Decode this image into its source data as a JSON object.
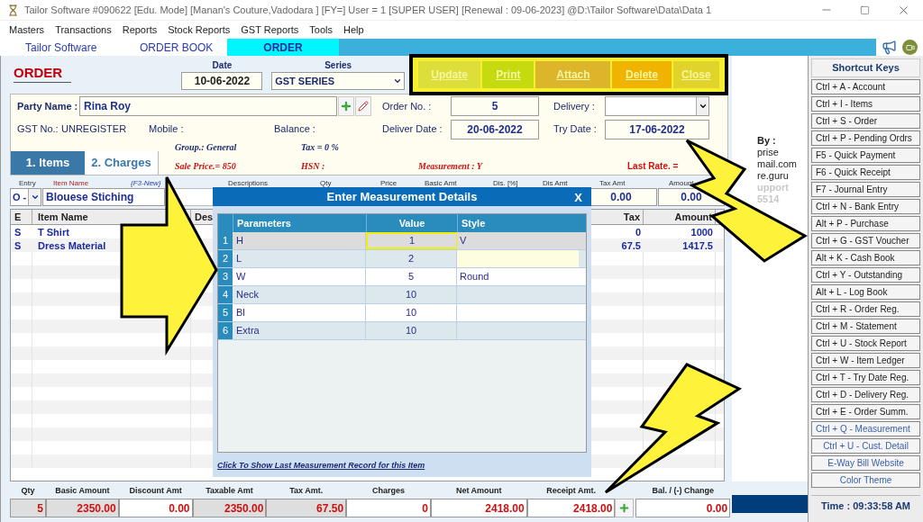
{
  "window": {
    "title": "Tailor Software #090622  [Edu. Mode] [Manan's Couture,Vadodara ] [FY=] User =  1 [SUPER USER]  [Renewal : 09-06-2023] @D:\\Tailor Software\\Data\\Data 1"
  },
  "menu": [
    "Masters",
    "Transactions",
    "Reports",
    "Stock Reports",
    "GST Reports",
    "Tools",
    "Help"
  ],
  "nav_tabs": [
    {
      "label": "Tailor Software",
      "selected": false
    },
    {
      "label": "ORDER BOOK",
      "selected": false
    },
    {
      "label": "ORDER",
      "selected": true
    }
  ],
  "form": {
    "title": "ORDER",
    "date_label": "Date",
    "date": "10-06-2022",
    "series_label": "Series",
    "series": "GST SERIES"
  },
  "actions": [
    {
      "label": "Update",
      "color": "#dede3a"
    },
    {
      "label": "Print",
      "color": "#c6da10"
    },
    {
      "label": "Attach",
      "color": "#dcb52a"
    },
    {
      "label": "Delete",
      "color": "#f0b400"
    },
    {
      "label": "Close",
      "color": "#e0d42a"
    }
  ],
  "party": {
    "name_label": "Party Name :",
    "name": "Rina Roy",
    "gst_label": "GST No.:",
    "gst": "UNREGISTER",
    "mobile_label": "Mobile :",
    "balance_label": "Balance :",
    "order_no_label": "Order No.  :",
    "order_no": "5",
    "deliver_date_label": "Deliver Date :",
    "deliver_date": "20-06-2022",
    "delivery_label": "Delivery :",
    "try_date_label": "Try Date  :",
    "try_date": "17-06-2022"
  },
  "item_info": {
    "group": "Group.: General",
    "tax": "Tax = 0 %",
    "sale_price": "Sale Price.= 850",
    "hsn": "HSN :",
    "measurement": "Measurement : Y",
    "last_rate": "Last Rate. ="
  },
  "section_tabs": [
    {
      "label": "1. Items",
      "selected": true
    },
    {
      "label": "2. Charges",
      "selected": false
    }
  ],
  "entry": {
    "headers": [
      "Entry",
      "Item Name",
      "{F3-New}",
      "Descriptions",
      "Qty",
      "Price",
      "Basic Amt",
      "Dis. [%]",
      "Dis Amt",
      "Tax Amt",
      "Amount"
    ],
    "type": "O -",
    "item": "Blouese Stiching",
    "tax_amt": "0.00",
    "amount": "0.00"
  },
  "items_table": {
    "columns": [
      "E",
      "Item Name",
      "Des",
      "Tax",
      "Amount"
    ],
    "rows": [
      {
        "e": "S",
        "item_name": "T Shirt",
        "tax": "0",
        "amount": "1000"
      },
      {
        "e": "S",
        "item_name": "Dress Material",
        "tax": "67.5",
        "amount": "1417.5"
      }
    ]
  },
  "contact": [
    {
      "text": "By :",
      "faded": false
    },
    {
      "text": "prise",
      "faded": false
    },
    {
      "text": "mail.com",
      "faded": false
    },
    {
      "text": "re.guru",
      "faded": false
    },
    {
      "text": "upport",
      "faded": true
    },
    {
      "text": "5514",
      "faded": true
    }
  ],
  "measurement_dialog": {
    "title": "Enter Measurement Details",
    "close": "X",
    "columns": [
      "Parameters",
      "Value",
      "Style"
    ],
    "rows": [
      {
        "no": "1",
        "parameter": "H",
        "value": "1",
        "style": "V",
        "selected": true,
        "style_active": false
      },
      {
        "no": "2",
        "parameter": "L",
        "value": "2",
        "style": "",
        "selected": false,
        "style_active": true
      },
      {
        "no": "3",
        "parameter": "W",
        "value": "5",
        "style": "Round",
        "selected": false,
        "style_active": false
      },
      {
        "no": "4",
        "parameter": "Neck",
        "value": "10",
        "style": "",
        "selected": false,
        "style_active": false
      },
      {
        "no": "5",
        "parameter": "Bl",
        "value": "10",
        "style": "",
        "selected": false,
        "style_active": false
      },
      {
        "no": "6",
        "parameter": "Extra",
        "value": "10",
        "style": "",
        "selected": false,
        "style_active": false
      }
    ],
    "link": "Click To Show Last Measurement Record for this Item"
  },
  "totals": [
    {
      "label": "Qty",
      "value": "5",
      "shaded": true
    },
    {
      "label": "Basic Amount",
      "value": "2350.00",
      "shaded": true
    },
    {
      "label": "Discount Amt",
      "value": "0.00",
      "shaded": false
    },
    {
      "label": "Taxable Amt",
      "value": "2350.00",
      "shaded": true
    },
    {
      "label": "Tax Amt.",
      "value": "67.50",
      "shaded": true
    },
    {
      "label": "Charges",
      "value": "0",
      "shaded": false
    },
    {
      "label": "Net Amount",
      "value": "2418.00",
      "shaded": false
    },
    {
      "label": "Receipt Amt.",
      "value": "2418.00",
      "shaded": false
    },
    {
      "label": "Bal. / (-) Change",
      "value": "0.00",
      "shaded": false
    }
  ],
  "shortcuts": {
    "title": "Shortcut Keys",
    "time": "Time : 09:33:58 AM",
    "items": [
      {
        "label": "Ctrl + A - Account",
        "kind": "key"
      },
      {
        "label": "Ctrl + I - Items",
        "kind": "key"
      },
      {
        "label": "Ctrl + S - Order",
        "kind": "key"
      },
      {
        "label": "Ctrl + P - Pending Ordrs",
        "kind": "key"
      },
      {
        "label": "F5 - Quick Payment",
        "kind": "key"
      },
      {
        "label": "F6 - Quick Receipt",
        "kind": "key"
      },
      {
        "label": "F7 - Journal Entry",
        "kind": "key"
      },
      {
        "label": "Ctrl + N - Bank Entry",
        "kind": "key"
      },
      {
        "label": "Alt + P - Purchase",
        "kind": "key"
      },
      {
        "label": "Ctrl + G - GST Voucher",
        "kind": "key"
      },
      {
        "label": "Alt + K - Cash Book",
        "kind": "key"
      },
      {
        "label": "Ctrl + Y  -  Outstanding",
        "kind": "key"
      },
      {
        "label": "Alt + L  -  Log Book",
        "kind": "key"
      },
      {
        "label": "Ctrl + R - Order Reg.",
        "kind": "key"
      },
      {
        "label": "Ctrl + M - Statement",
        "kind": "key"
      },
      {
        "label": "Ctrl + U - Stock Report",
        "kind": "key"
      },
      {
        "label": "Ctrl + W - Item Ledger",
        "kind": "key"
      },
      {
        "label": "Ctrl + T - Try Date Reg.",
        "kind": "key"
      },
      {
        "label": "Ctrl + D - Delivery Reg.",
        "kind": "key"
      },
      {
        "label": "Ctrl + E - Order Summ.",
        "kind": "key"
      },
      {
        "label": "Ctrl + Q - Measurement",
        "kind": "highlight"
      },
      {
        "label": "Ctrl + U - Cust. Detail",
        "kind": "tool"
      },
      {
        "label": "E-Way Bill Website",
        "kind": "tool"
      },
      {
        "label": "Color Theme",
        "kind": "tool"
      }
    ]
  }
}
